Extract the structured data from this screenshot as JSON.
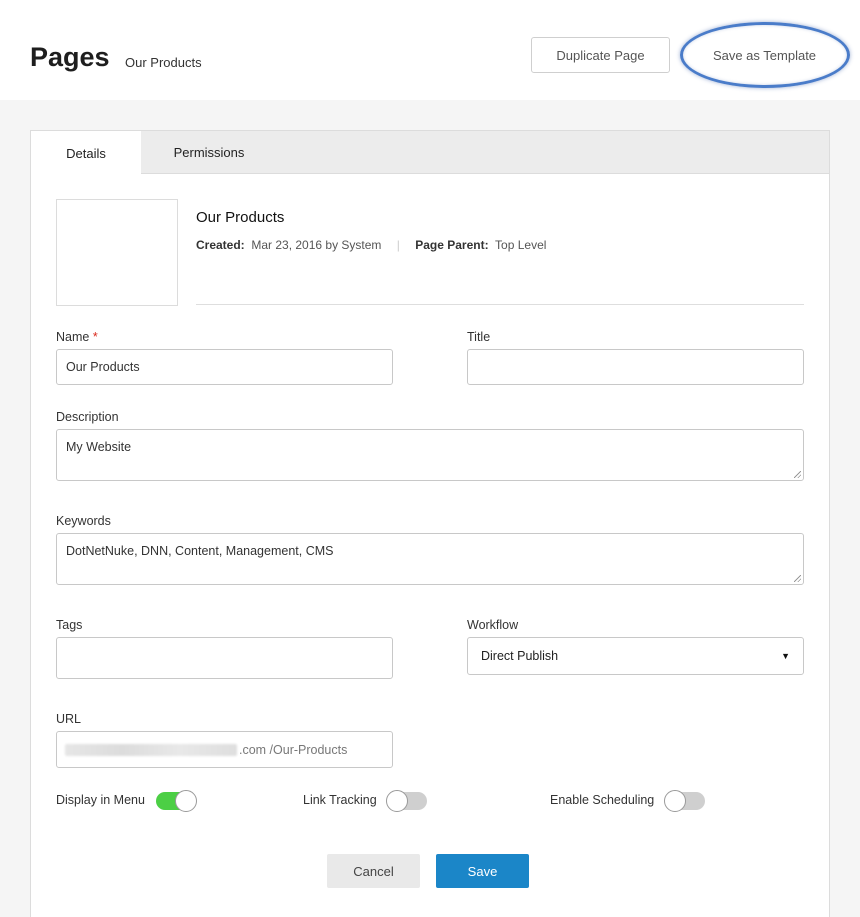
{
  "header": {
    "title": "Pages",
    "subtitle": "Our Products",
    "duplicate_label": "Duplicate Page",
    "save_template_label": "Save as Template",
    "highlight_color": "#4a7cc9"
  },
  "tabs": [
    {
      "label": "Details",
      "active": true
    },
    {
      "label": "Permissions",
      "active": false
    }
  ],
  "info": {
    "page_name": "Our Products",
    "created_label": "Created:",
    "created_value": "Mar 23, 2016 by System",
    "parent_label": "Page Parent:",
    "parent_value": "Top Level"
  },
  "form": {
    "name_label": "Name",
    "name_required_mark": "*",
    "name_value": "Our Products",
    "title_label": "Title",
    "title_value": "",
    "description_label": "Description",
    "description_value": "My Website",
    "keywords_label": "Keywords",
    "keywords_value": "DotNetNuke, DNN, Content, Management, CMS",
    "tags_label": "Tags",
    "tags_value": "",
    "workflow_label": "Workflow",
    "workflow_value": "Direct Publish",
    "url_label": "URL",
    "url_suffix": ".com /Our-Products"
  },
  "toggles": {
    "display_in_menu": {
      "label": "Display in Menu",
      "on": true
    },
    "link_tracking": {
      "label": "Link Tracking",
      "on": false
    },
    "enable_scheduling": {
      "label": "Enable Scheduling",
      "on": false
    }
  },
  "actions": {
    "cancel_label": "Cancel",
    "save_label": "Save",
    "save_color": "#1b86c8"
  }
}
